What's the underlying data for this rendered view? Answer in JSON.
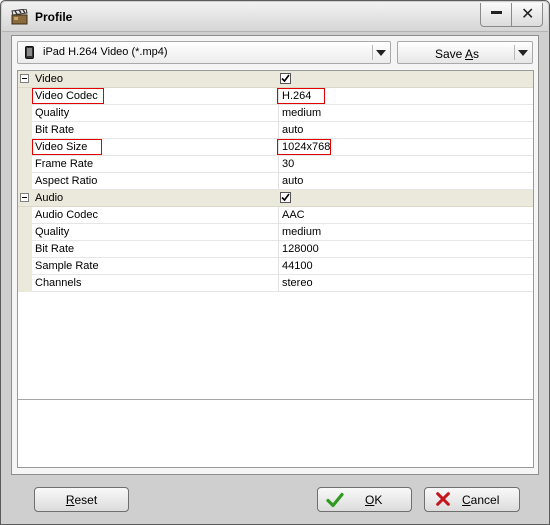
{
  "window": {
    "title": "Profile"
  },
  "profile_select": {
    "selected": "iPad H.264 Video (*.mp4)"
  },
  "save_as": {
    "label_before": "Save ",
    "label_underlined": "A",
    "label_after": "s"
  },
  "properties": {
    "video": {
      "label": "Video",
      "enabled": true,
      "rows": [
        {
          "name": "Video Codec",
          "value": "H.264"
        },
        {
          "name": "Quality",
          "value": "medium"
        },
        {
          "name": "Bit Rate",
          "value": "auto"
        },
        {
          "name": "Video Size",
          "value": "1024x768"
        },
        {
          "name": "Frame Rate",
          "value": "30"
        },
        {
          "name": "Aspect Ratio",
          "value": "auto"
        }
      ]
    },
    "audio": {
      "label": "Audio",
      "enabled": true,
      "rows": [
        {
          "name": "Audio Codec",
          "value": "AAC"
        },
        {
          "name": "Quality",
          "value": "medium"
        },
        {
          "name": "Bit Rate",
          "value": "128000"
        },
        {
          "name": "Sample Rate",
          "value": "44100"
        },
        {
          "name": "Channels",
          "value": "stereo"
        }
      ]
    }
  },
  "buttons": {
    "reset": {
      "underlined": "R",
      "rest": "eset"
    },
    "ok": {
      "underlined": "O",
      "rest": "K"
    },
    "cancel": {
      "underlined": "C",
      "rest": "ancel"
    }
  },
  "colors": {
    "highlight_box": "#e00000",
    "ok_check": "#2f9a1f",
    "cancel_x": "#c4161c",
    "category_bg": "#ebe8dc"
  },
  "icons": {
    "title": "clapperboard-icon",
    "profile": "ipad-device-icon",
    "ok": "checkmark-icon",
    "cancel": "red-x-icon"
  }
}
